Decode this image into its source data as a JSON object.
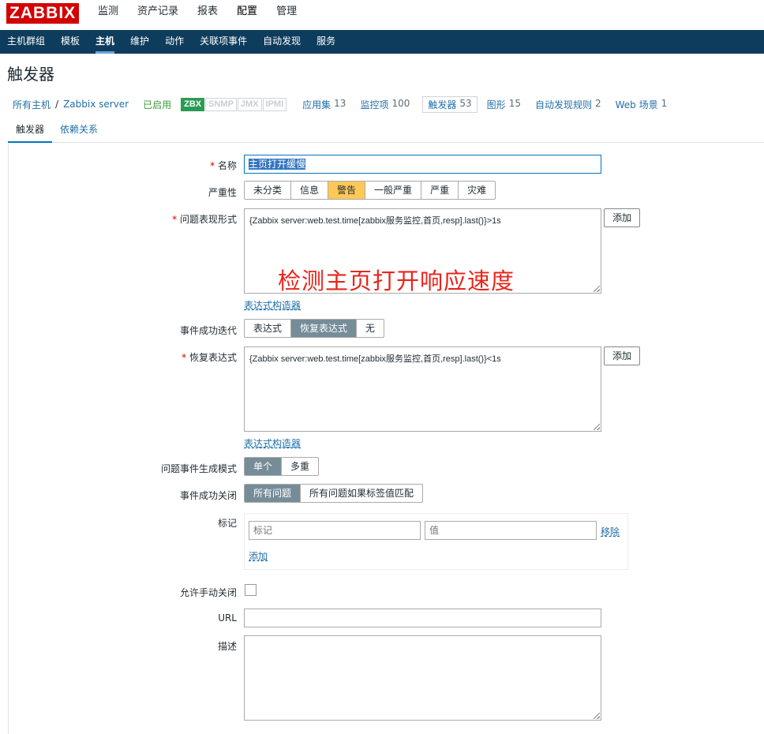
{
  "logo": "ZABBIX",
  "top_menu": [
    "监测",
    "资产记录",
    "报表",
    "配置",
    "管理"
  ],
  "sub_menu": [
    "主机群组",
    "模板",
    "主机",
    "维护",
    "动作",
    "关联项事件",
    "自动发现",
    "服务"
  ],
  "page_title": "触发器",
  "breadcrumb": {
    "all_hosts": "所有主机",
    "separator": "/",
    "host": "Zabbix server",
    "status": "已启用",
    "availability": [
      "ZBX",
      "SNMP",
      "JMX",
      "IPMI"
    ],
    "applications": {
      "label": "应用集",
      "count": "13"
    },
    "items": {
      "label": "监控项",
      "count": "100"
    },
    "triggers": {
      "label": "触发器",
      "count": "53"
    },
    "graphs": {
      "label": "图形",
      "count": "15"
    },
    "discovery": {
      "label": "自动发现规则",
      "count": "2"
    },
    "web": {
      "label": "Web 场景",
      "count": "1"
    }
  },
  "tabs": {
    "trigger": "触发器",
    "dependencies": "依赖关系"
  },
  "form": {
    "name_label": "名称",
    "name_value": "主页打开缓慢",
    "severity_label": "严重性",
    "severity_options": [
      "未分类",
      "信息",
      "警告",
      "一般严重",
      "严重",
      "灾难"
    ],
    "severity_selected": "警告",
    "expression_label": "问题表现形式",
    "expression_value": "{Zabbix server:web.test.time[zabbix服务监控,首页,resp].last()}>1s",
    "add_label": "添加",
    "expression_builder": "表达式构造器",
    "annotation_text": "检测主页打开响应速度",
    "ok_event_label": "事件成功迭代",
    "ok_event_options": [
      "表达式",
      "恢复表达式",
      "无"
    ],
    "ok_event_selected": "恢复表达式",
    "recovery_label": "恢复表达式",
    "recovery_value": "{Zabbix server:web.test.time[zabbix服务监控,首页,resp].last()}<1s",
    "problem_mode_label": "问题事件生成模式",
    "problem_mode_options": [
      "单个",
      "多重"
    ],
    "problem_mode_selected": "单个",
    "ok_close_label": "事件成功关闭",
    "ok_close_options": [
      "所有问题",
      "所有问题如果标签值匹配"
    ],
    "ok_close_selected": "所有问题",
    "tags_label": "标记",
    "tag_placeholder": "标记",
    "value_placeholder": "值",
    "remove_label": "移除",
    "tags_add_label": "添加",
    "manual_close_label": "允许手动关闭",
    "url_label": "URL",
    "description_label": "描述"
  },
  "colors": {
    "brand_red": "#d40000",
    "nav_blue": "#0e3c5c",
    "warning": "#ffc859",
    "selected_gray": "#768d99",
    "link": "#1f6fa8"
  }
}
